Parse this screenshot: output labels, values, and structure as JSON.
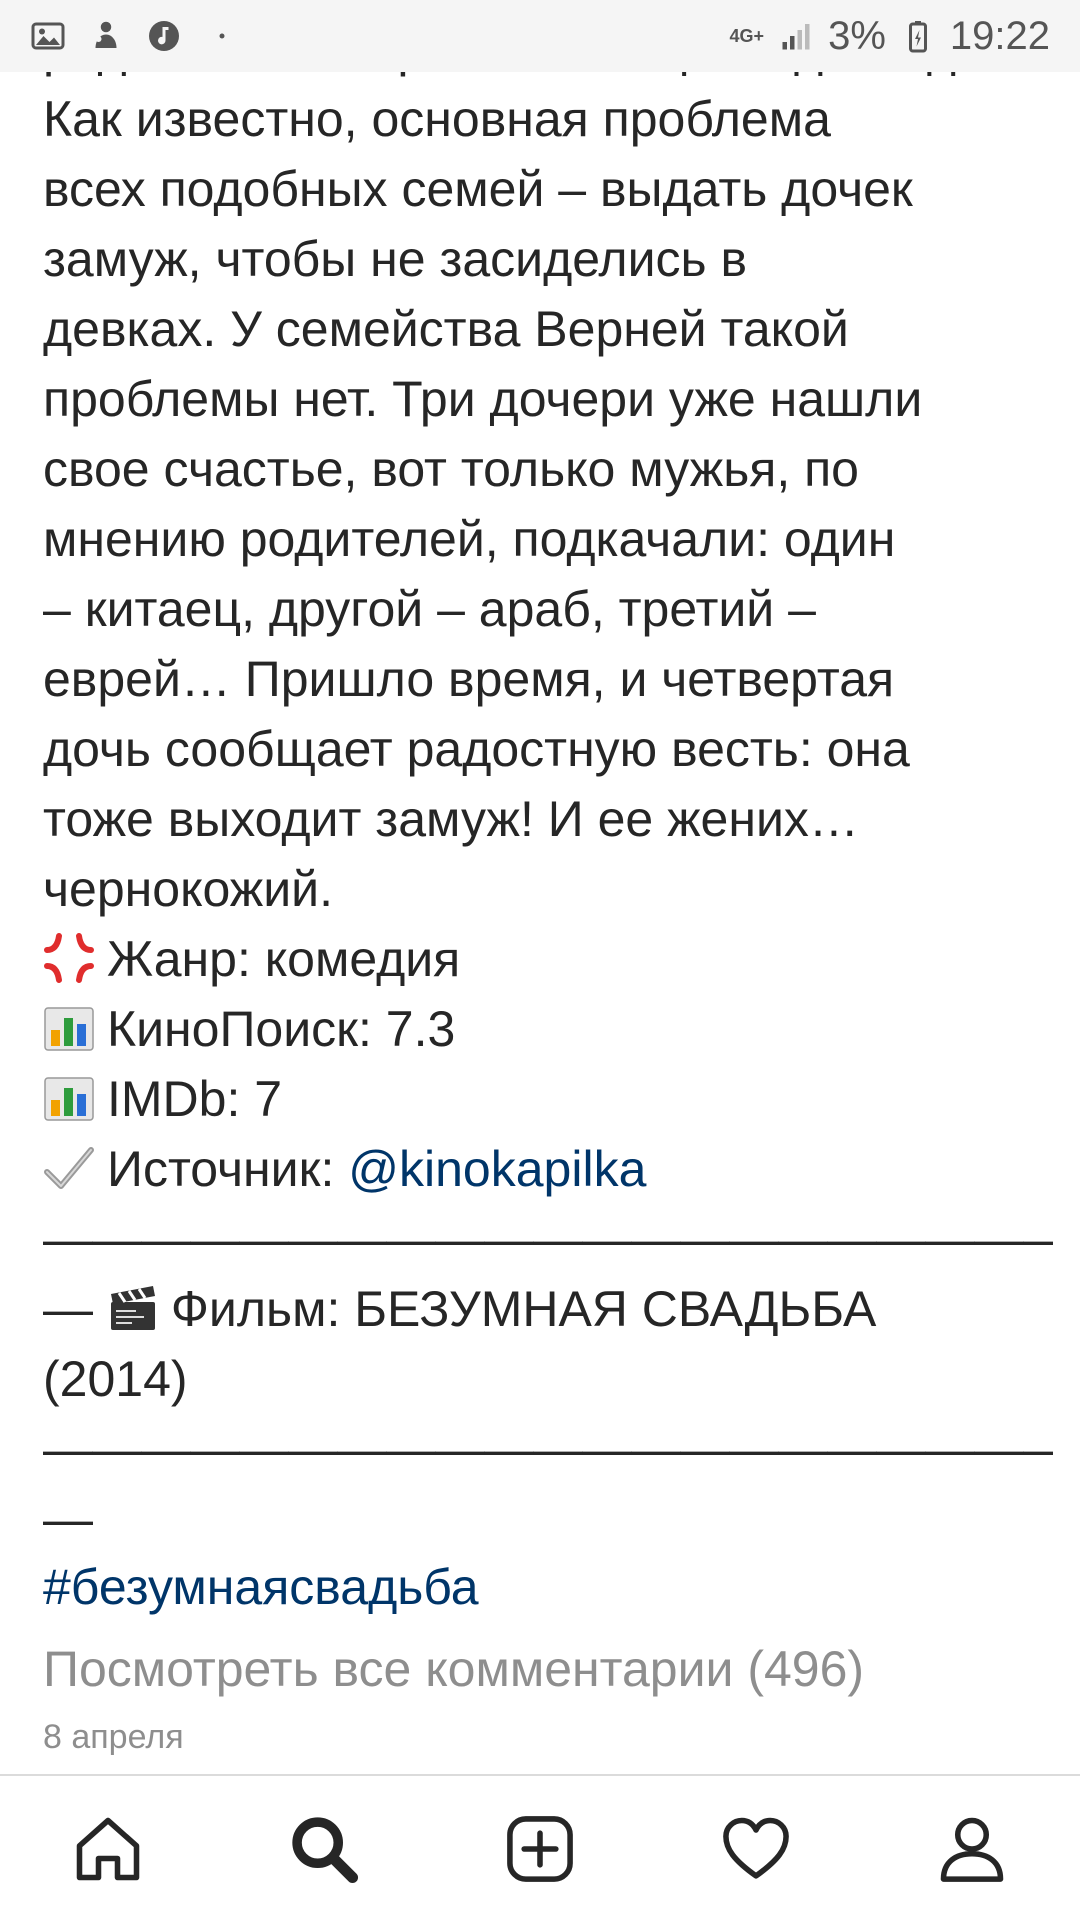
{
  "status_bar": {
    "network": "4G+",
    "battery": "3%",
    "time": "19:22"
  },
  "post": {
    "cut_line": "родителями с третьим и еще с одним д",
    "caption_lines": [
      "Как известно, основная проблема",
      "всех подобных семей – выдать дочек",
      "замуж, чтобы не засиделись в",
      "девках. У семейства Верней такой",
      "проблемы нет. Три дочери уже нашли",
      "свое счастье, вот только мужья, по",
      "мнению родителей, подкачали: один",
      "– китаец, другой – араб, третий –",
      "еврей… Пришло время, и четвертая",
      "дочь сообщает радостную весть: она",
      "тоже выходит замуж! И ее жених…",
      "чернокожий."
    ],
    "genre": {
      "icon": "anger-symbol-icon",
      "label": "Жанр:  комедия"
    },
    "kinopoisk": {
      "icon": "bar-chart-icon",
      "label": "КиноПоиск: 7.3"
    },
    "imdb": {
      "icon": "bar-chart-icon",
      "label": "IMDb: 7"
    },
    "source": {
      "icon": "check-mark-icon",
      "label": "Источник: ",
      "link": "@kinokapilka"
    },
    "dashes_1": "————————————————————————",
    "film_line_prefix": "— ",
    "film": {
      "icon": "clapper-board-icon",
      "label": "Фильм: БЕЗУМНАЯ СВАДЬБА"
    },
    "film_year": "(2014)",
    "dashes_2": "————————————————————————",
    "dashes_3": "—",
    "hashtag": "#безумнаясвадьба",
    "view_comments": "Посмотреть все комментарии (496)",
    "date": "8 апреля"
  },
  "nav": {
    "items": [
      "home-icon",
      "search-icon",
      "add-post-icon",
      "heart-icon",
      "profile-icon"
    ]
  },
  "colors": {
    "text": "#262626",
    "link": "#003569",
    "muted": "#8e8e8e",
    "status_bg": "#f5f5f5"
  }
}
